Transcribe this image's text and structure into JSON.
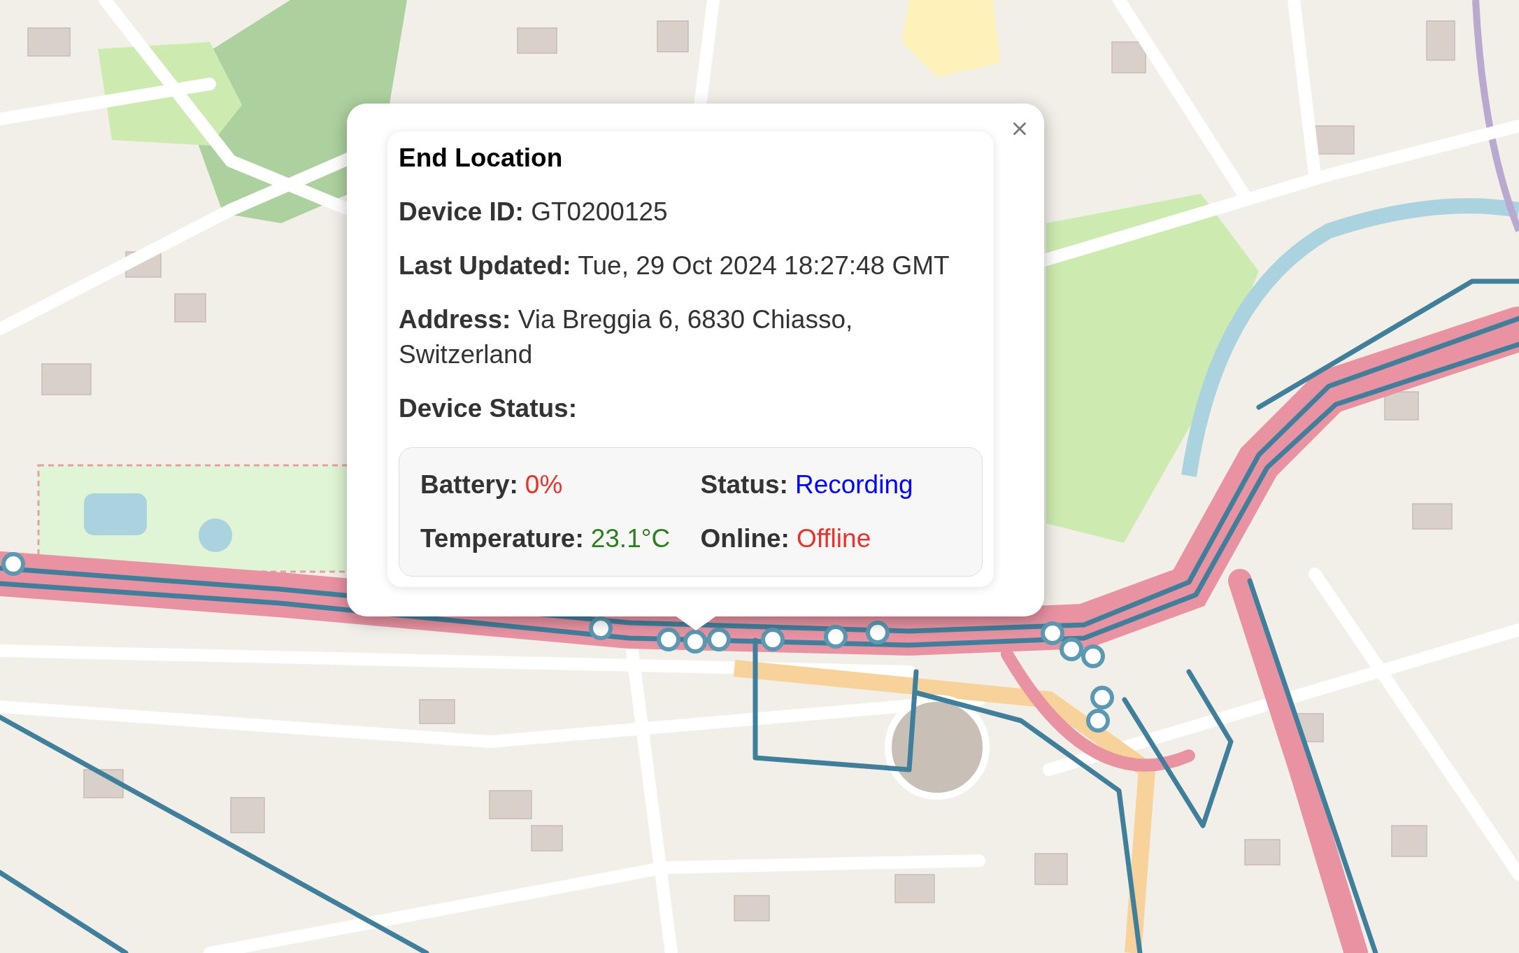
{
  "popup": {
    "title": "End Location",
    "fields": [
      {
        "label": "Device ID:",
        "value": "GT0200125"
      },
      {
        "label": "Last Updated:",
        "value": "Tue, 29 Oct 2024 18:27:48 GMT"
      },
      {
        "label": "Address:",
        "value": "Via Breggia 6, 6830 Chiasso, Switzerland"
      }
    ],
    "section_heading": "Device Status:",
    "status": [
      {
        "label": "Battery:",
        "value": "0%",
        "color": "#e8322b"
      },
      {
        "label": "Status:",
        "value": "Recording",
        "color": "#0000ff"
      },
      {
        "label": "Temperature:",
        "value": "23.1°C",
        "color": "#2e7d1e"
      },
      {
        "label": "Online:",
        "value": "Offline",
        "color": "#e8322b"
      }
    ]
  }
}
